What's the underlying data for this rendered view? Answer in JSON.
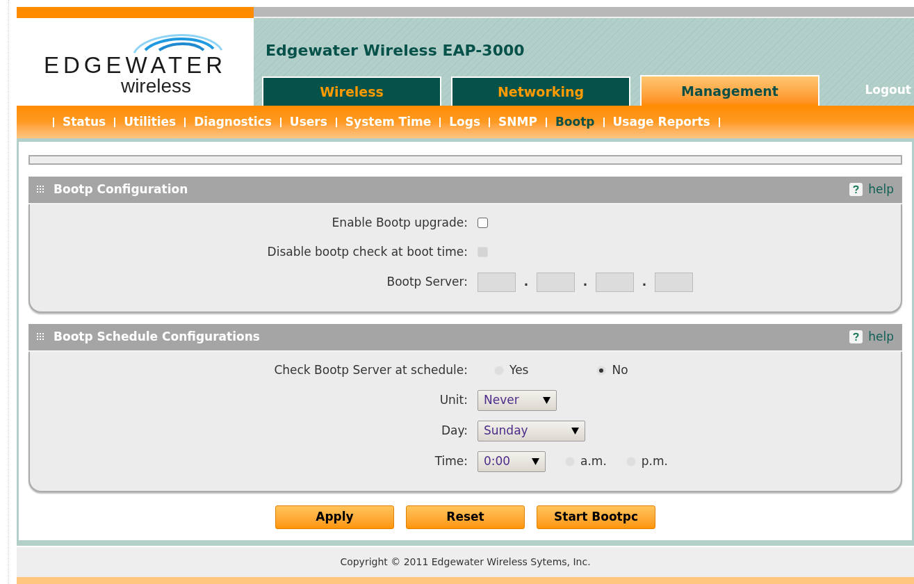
{
  "header": {
    "logo": {
      "wordmark": "EDGEWATER",
      "tagline": "wireless"
    },
    "title": "Edgewater Wireless EAP-3000"
  },
  "tabs": [
    {
      "label": "Wireless",
      "selected": false
    },
    {
      "label": "Networking",
      "selected": false
    },
    {
      "label": "Management",
      "selected": true
    }
  ],
  "logout": "Logout",
  "subnav": [
    {
      "label": "Status",
      "selected": false
    },
    {
      "label": "Utilities",
      "selected": false
    },
    {
      "label": "Diagnostics",
      "selected": false
    },
    {
      "label": "Users",
      "selected": false
    },
    {
      "label": "System Time",
      "selected": false
    },
    {
      "label": "Logs",
      "selected": false
    },
    {
      "label": "SNMP",
      "selected": false
    },
    {
      "label": "Bootp",
      "selected": true
    },
    {
      "label": "Usage Reports",
      "selected": false
    }
  ],
  "sections": [
    {
      "title": "Bootp Configuration",
      "help": "help",
      "fields": [
        {
          "kind": "checkbox",
          "label": "Enable Bootp upgrade:",
          "checked": false,
          "disabled": false
        },
        {
          "kind": "checkbox",
          "label": "Disable bootp check at boot time:",
          "checked": false,
          "disabled": true
        },
        {
          "kind": "ip",
          "label": "Bootp Server:",
          "separators": [
            ".",
            ".",
            "."
          ]
        }
      ]
    },
    {
      "title": "Bootp Schedule Configurations",
      "help": "help",
      "fields": [
        {
          "kind": "radio",
          "label": "Check Bootp Server at schedule:",
          "options": [
            {
              "label": "Yes",
              "selected": false
            },
            {
              "label": "No",
              "selected": true
            }
          ]
        },
        {
          "kind": "select",
          "label": "Unit:",
          "value": "Never"
        },
        {
          "kind": "select",
          "label": "Day:",
          "value": "Sunday"
        },
        {
          "kind": "select",
          "label": "Time:",
          "value": "0:00",
          "options": [
            {
              "label": "a.m.",
              "selected": false
            },
            {
              "label": "p.m.",
              "selected": false
            }
          ]
        }
      ]
    }
  ],
  "buttons": [
    "Apply",
    "Reset",
    "Start Bootpc"
  ],
  "footer": "Copyright © 2011 Edgewater Wireless Sytems, Inc."
}
